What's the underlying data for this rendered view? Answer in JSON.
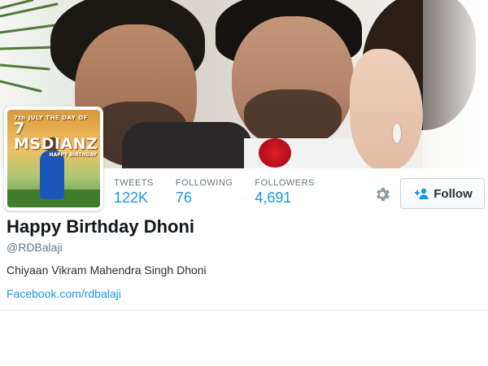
{
  "avatar": {
    "line1": "7th JULY THE DAY OF",
    "line2": "7 MSDIANZ",
    "line3": "HAPPY BIRTHDAY"
  },
  "stats": [
    {
      "label": "TWEETS",
      "value": "122K"
    },
    {
      "label": "FOLLOWING",
      "value": "76"
    },
    {
      "label": "FOLLOWERS",
      "value": "4,691"
    }
  ],
  "actions": {
    "settings_icon": "gear-icon",
    "follow_icon": "add-user-icon",
    "follow_label": "Follow"
  },
  "profile": {
    "name": "Happy Birthday Dhoni",
    "handle": "@RDBalaji",
    "bio": "Chiyaan Vikram Mahendra Singh Dhoni",
    "url": "Facebook.com/rdbalaji"
  },
  "colors": {
    "link": "#1b95e0",
    "muted": "#66757f",
    "text": "#292f33"
  }
}
